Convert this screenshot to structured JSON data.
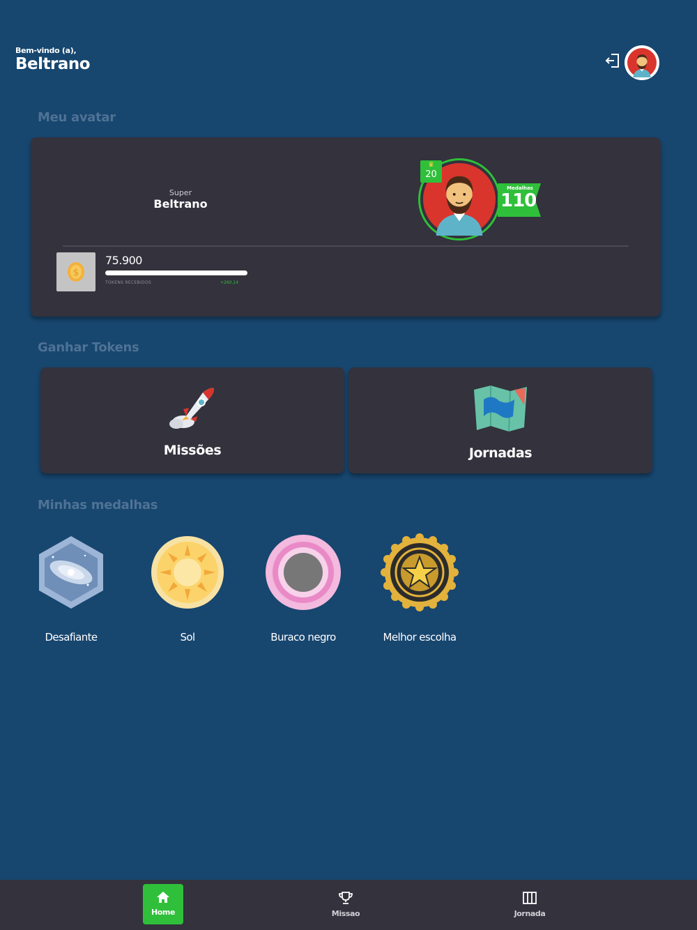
{
  "header": {
    "greeting": "Bem-vindo (a),",
    "username": "Beltrano"
  },
  "icons": {
    "logout": "logout-icon",
    "coin": "coin-icon",
    "rocket": "rocket-icon",
    "map": "map-icon",
    "home": "home-icon",
    "trophy": "trophy-icon",
    "columns": "columns-icon"
  },
  "sections": {
    "avatar": "Meu avatar",
    "tokens": "Ganhar Tokens",
    "medals": "Minhas medalhas"
  },
  "avatar_card": {
    "title_label": "Super",
    "name": "Beltrano",
    "level": "20",
    "medals_label": "Medalhas",
    "medals_count": "110",
    "tokens_value": "75.900",
    "tokens_caption": "TOKENS RECEBIDOS",
    "tokens_delta": "+260,14",
    "tokens_progress": 1.0
  },
  "earn_tokens": [
    {
      "label": "Missões"
    },
    {
      "label": "Jornadas"
    }
  ],
  "medals": [
    {
      "label": "Desafiante"
    },
    {
      "label": "Sol"
    },
    {
      "label": "Buraco negro"
    },
    {
      "label": "Melhor escolha"
    }
  ],
  "nav": [
    {
      "label": "Home",
      "active": true
    },
    {
      "label": "Missao",
      "active": false
    },
    {
      "label": "Jornada",
      "active": false
    }
  ],
  "colors": {
    "background": "#17466f",
    "card": "#33323d",
    "accent_green": "#2fbf3a",
    "section_title": "#4f7295"
  }
}
